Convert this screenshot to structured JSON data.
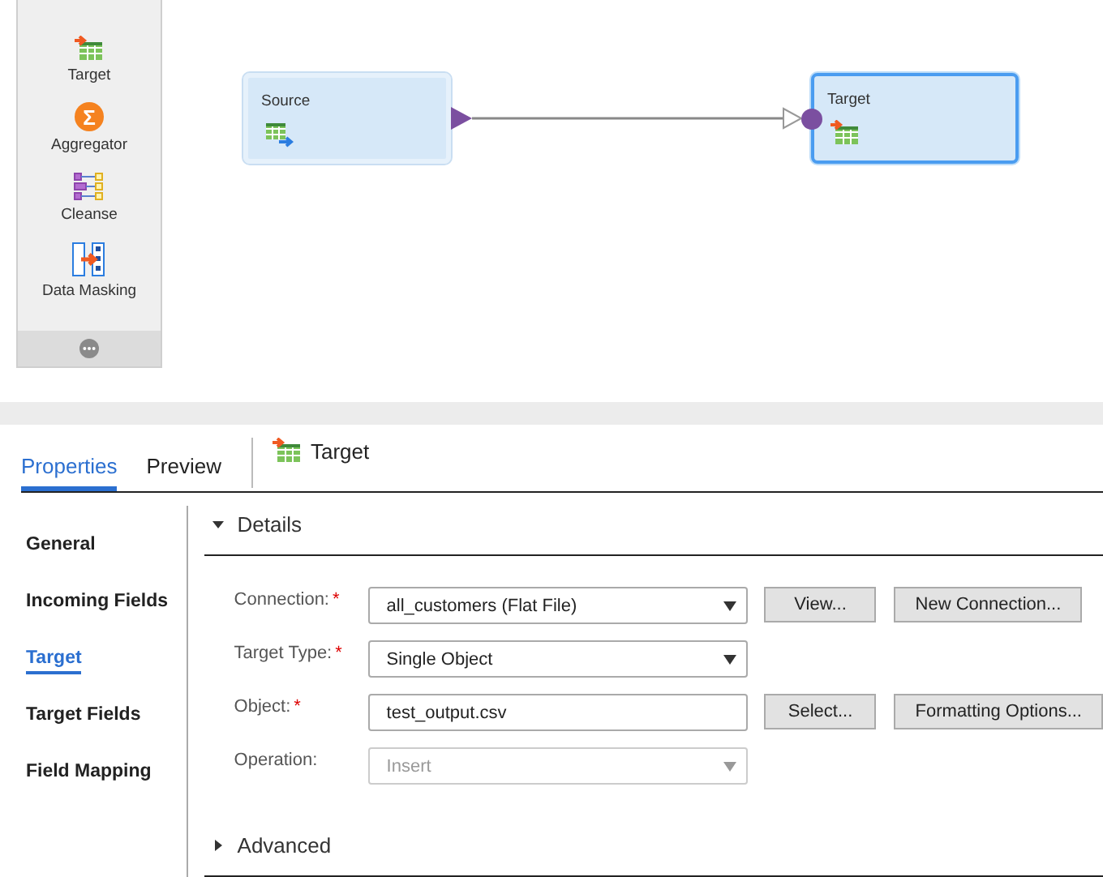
{
  "palette": {
    "items": [
      {
        "label": "Target",
        "kind": "target"
      },
      {
        "label": "Aggregator",
        "kind": "aggregator",
        "icon": "Σ"
      },
      {
        "label": "Cleanse",
        "kind": "cleanse"
      },
      {
        "label": "Data Masking",
        "kind": "masking"
      }
    ]
  },
  "canvas": {
    "nodes": [
      {
        "label": "Source",
        "kind": "source",
        "selected": false
      },
      {
        "label": "Target",
        "kind": "target",
        "selected": true
      }
    ]
  },
  "panel": {
    "tabs": [
      {
        "label": "Properties",
        "selected": true
      },
      {
        "label": "Preview",
        "selected": false
      }
    ],
    "title": "Target",
    "nav": [
      {
        "label": "General",
        "selected": false
      },
      {
        "label": "Incoming Fields",
        "selected": false
      },
      {
        "label": "Target",
        "selected": true
      },
      {
        "label": "Target Fields",
        "selected": false
      },
      {
        "label": "Field Mapping",
        "selected": false
      }
    ],
    "details": {
      "title": "Details",
      "expanded": true,
      "fields": [
        {
          "label": "Connection:",
          "required_mark": "*",
          "kind": "select",
          "value": "all_customers (Flat File)",
          "disabled": false,
          "buttons": [
            "View...",
            "New Connection..."
          ]
        },
        {
          "label": "Target Type:",
          "required_mark": "*",
          "kind": "select",
          "value": "Single Object",
          "disabled": false
        },
        {
          "label": "Object:",
          "required_mark": "*",
          "kind": "text",
          "value": "test_output.csv",
          "disabled": false,
          "buttons": [
            "Select...",
            "Formatting Options..."
          ]
        },
        {
          "label": "Operation:",
          "kind": "select",
          "value": "Insert",
          "disabled": true
        }
      ]
    },
    "advanced": {
      "title": "Advanced",
      "expanded": false
    }
  }
}
